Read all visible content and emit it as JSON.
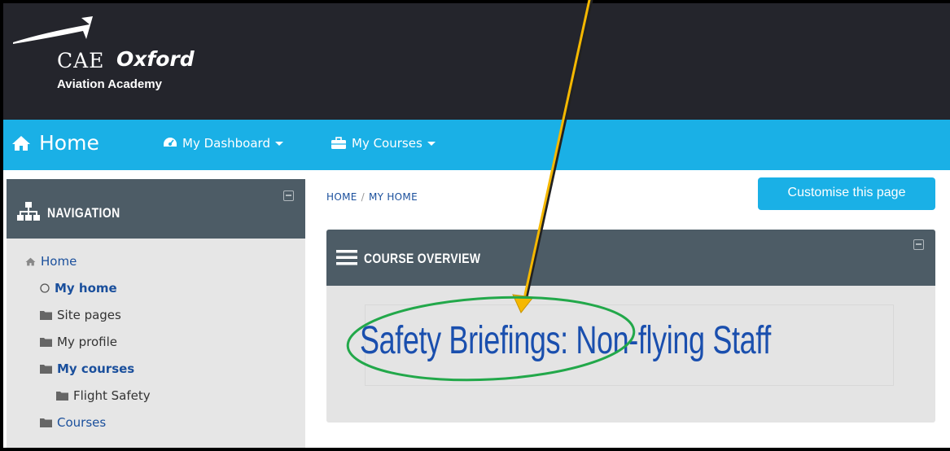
{
  "brand": {
    "line1": "CAE",
    "line1_b": "Oxford",
    "line2": "Aviation Academy"
  },
  "navbar": {
    "home": "Home",
    "dashboard": "My Dashboard",
    "courses": "My Courses"
  },
  "navigation": {
    "title": "NAVIGATION",
    "items": [
      {
        "label": "Home",
        "icon": "home-icon"
      },
      {
        "label": "My home",
        "icon": "circle-icon"
      },
      {
        "label": "Site pages",
        "icon": "folder-icon"
      },
      {
        "label": "My profile",
        "icon": "folder-icon"
      },
      {
        "label": "My courses",
        "icon": "folder-icon"
      },
      {
        "label": "Flight Safety",
        "icon": "folder-icon"
      },
      {
        "label": "Courses",
        "icon": "folder-icon"
      }
    ]
  },
  "breadcrumb": {
    "home": "HOME",
    "sep": "/",
    "current": "MY HOME"
  },
  "customise_button": "Customise this page",
  "course_overview": {
    "title": "COURSE OVERVIEW",
    "course_name": "Safety Briefings: Non-flying Staff"
  },
  "colors": {
    "header_bg": "#24252c",
    "navbar_bg": "#1ab0e6",
    "block_head_bg": "#4d5c66",
    "link": "#1a4f9c",
    "annotation_arrow": "#f5b800",
    "annotation_ellipse": "#22a84a"
  }
}
